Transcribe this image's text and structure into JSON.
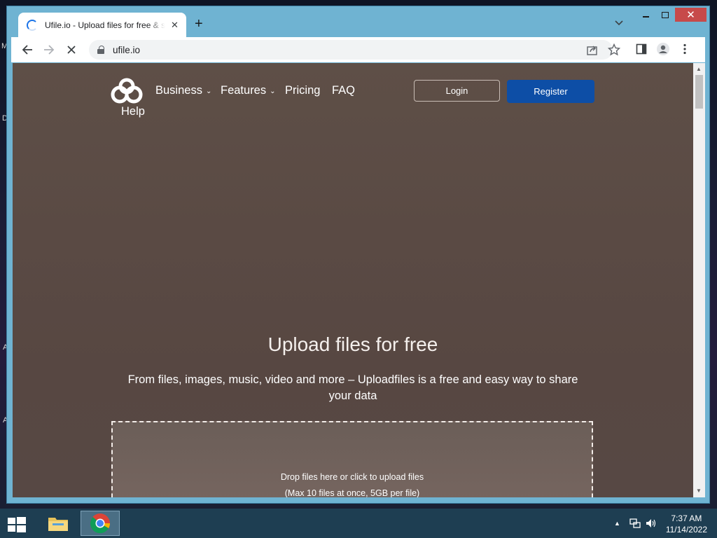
{
  "browser": {
    "tab_title": "Ufile.io - Upload files for free & s",
    "url": "ufile.io"
  },
  "site": {
    "nav": {
      "business": "Business",
      "features": "Features",
      "pricing": "Pricing",
      "faq": "FAQ",
      "help": "Help"
    },
    "login_label": "Login",
    "register_label": "Register",
    "hero": {
      "title": "Upload files for free",
      "subtitle": "From files, images, music, video and more – Uploadfiles is a free and easy way to share your data"
    },
    "dropzone": {
      "line1": "Drop files here or click to upload files",
      "line2": "(Max 10 files at once, 5GB per file)"
    }
  },
  "taskbar": {
    "time": "7:37 AM",
    "date": "11/14/2022"
  },
  "desktop_fragments": [
    "M",
    "D",
    "A",
    "A"
  ],
  "colors": {
    "register_bg": "#0d4ea6",
    "window_frame": "#6fb3d2",
    "close_button": "#c74a4a",
    "taskbar": "#1e3e52"
  }
}
